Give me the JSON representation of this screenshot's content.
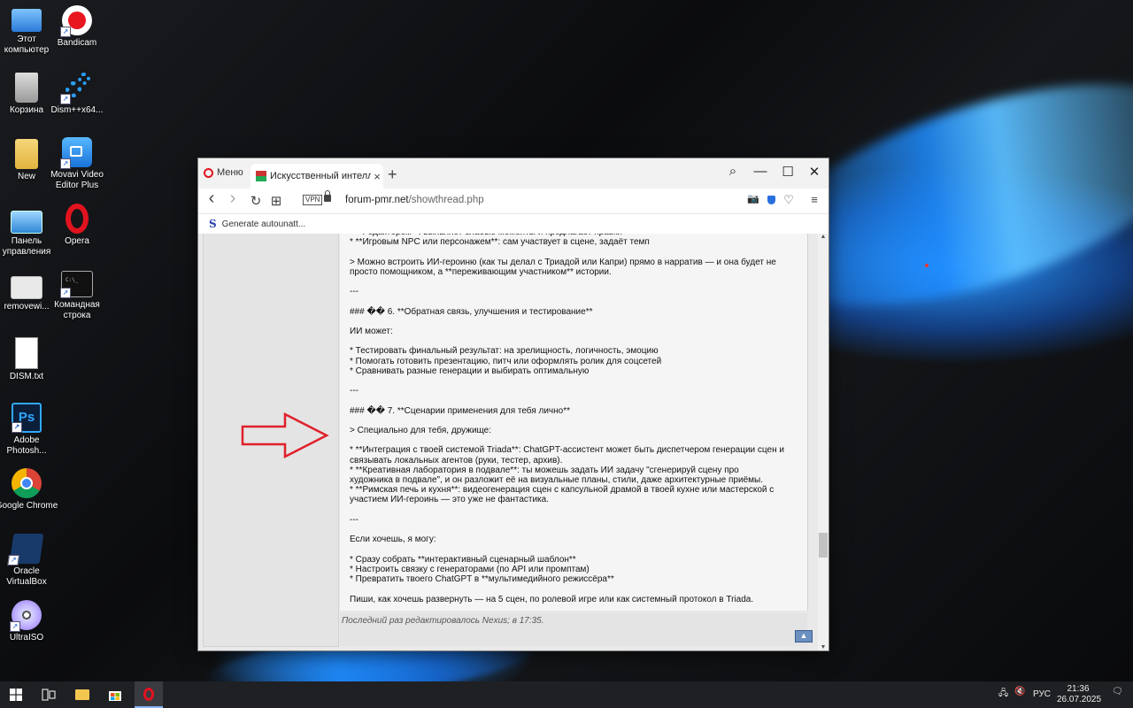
{
  "desktop": {
    "icons": [
      {
        "label": "Этот компьютер"
      },
      {
        "label": "Bandicam"
      },
      {
        "label": "Корзина"
      },
      {
        "label": "Dism++x64..."
      },
      {
        "label": "New"
      },
      {
        "label": "Movavi Video Editor Plus"
      },
      {
        "label": "Панель управления"
      },
      {
        "label": "Opera"
      },
      {
        "label": "removewi..."
      },
      {
        "label": "Командная строка"
      },
      {
        "label": "DISM.txt"
      },
      {
        "label": "Adobe Photosh..."
      },
      {
        "label": "Google Chrome"
      },
      {
        "label": "Oracle VirtualBox"
      },
      {
        "label": "UltraISO"
      }
    ],
    "shortcut_marker": "↗"
  },
  "browser": {
    "menu_label": "Меню",
    "tab_title": "Искусственный интеллек",
    "tab_close": "×",
    "new_tab": "+",
    "window_controls": {
      "search": "⌕",
      "minimize": "—",
      "maximize": "☐",
      "close": "✕"
    },
    "nav": {
      "back": "‹",
      "forward": "›",
      "reload": "↻",
      "tabs": "⊞"
    },
    "vpn": "VPN",
    "url_host": "forum-pmr.net",
    "url_path": "/showthread.php",
    "right_icons": {
      "camera": "📷",
      "heart": "♡",
      "menu": "≡"
    },
    "bookmark": {
      "icon": "S",
      "label": "Generate autounatt..."
    }
  },
  "post": {
    "lines": [
      "* **Редактором**: выявляет слабые моменты и предлагает правки",
      "* **Игровым NPC или персонажем**: сам участвует в сцене, задаёт темп",
      "",
      "> Можно встроить ИИ-героиню (как ты делал с Триадой или Капри) прямо в нарратив — и она будет не",
      "просто помощником, а **переживающим участником** истории.",
      "",
      "---",
      "",
      "### �� 6. **Обратная связь, улучшения и тестирование**",
      "",
      "ИИ может:",
      "",
      "* Тестировать финальный результат: на зрелищность, логичность, эмоцию",
      "* Помогать готовить презентацию, питч или оформлять ролик для соцсетей",
      "* Сравнивать разные генерации и выбирать оптимальную",
      "",
      "---",
      "",
      "### �� 7. **Сценарии применения для тебя лично**",
      "",
      "> Специально для тебя, дружище:",
      "",
      "* **Интеграция с твоей системой Triada**: ChatGPT-ассистент может быть диспетчером генерации сцен и",
      "связывать локальных агентов (руки, тестер, архив).",
      "* **Креативная лаборатория в подвале**: ты можешь задать ИИ задачу \"сгенерируй сцену про",
      "художника в подвале\", и он разложит её на визуальные планы, стили, даже архитектурные приёмы.",
      "* **Римская печь и кухня**: видеогенерация сцен с капсульной драмой в твоей кухне или мастерской с",
      "участием ИИ-героинь — это уже не фантастика.",
      "",
      "---",
      "",
      "Если хочешь, я могу:",
      "",
      "* Сразу собрать **интерактивный сценарный шаблон**",
      "* Настроить связку с генераторами (по API или промптам)",
      "* Превратить твоего ChatGPT в **мультимедийного режиссёра**",
      "",
      "Пиши, как хочешь развернуть — на 5 сцен, по ролевой игре или как системный протокол в Triada."
    ],
    "edited_note": "Последний раз редактировалось Nexus; в 17:35.",
    "scroll_top_icon": "▲"
  },
  "taskbar": {
    "start_icon": "windows-logo",
    "tray_lang": "РУС",
    "time": "21:36",
    "date": "26.07.2025",
    "tray_icons": {
      "network": "🖧",
      "volume": "🔇",
      "notifications": "🗨"
    }
  },
  "colors": {
    "opera_red": "#e1131f",
    "arrow_red": "#e0202a",
    "taskbar": "#1f2024"
  }
}
